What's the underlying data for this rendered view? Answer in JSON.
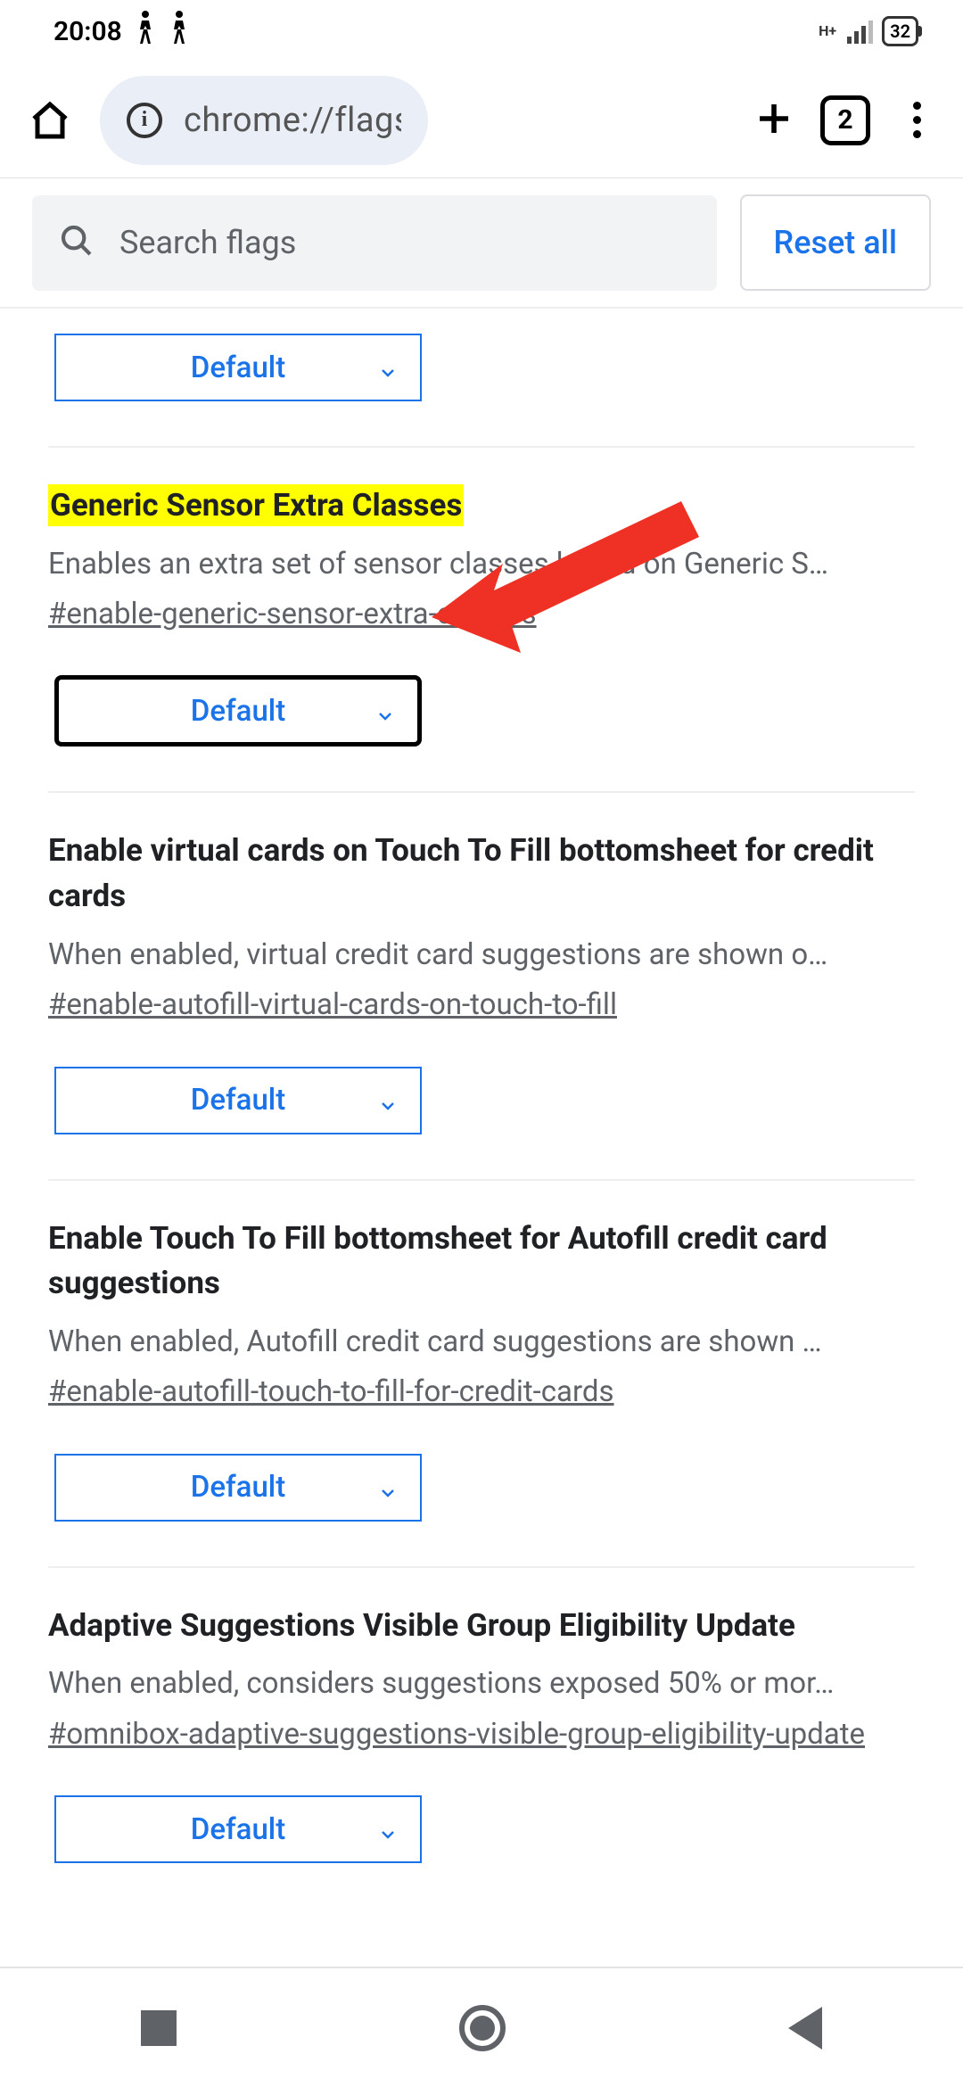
{
  "statusbar": {
    "time": "20:08",
    "network_label": "H+",
    "battery_pct": "32"
  },
  "browser": {
    "url": "chrome://flags/#enab",
    "tab_count": "2"
  },
  "search": {
    "placeholder": "Search flags",
    "reset_label": "Reset all"
  },
  "flags": [
    {
      "title": "",
      "dropdown": "Default"
    },
    {
      "title": "Generic Sensor Extra Classes",
      "desc": "Enables an extra set of sensor classes based on Generic S…",
      "anchor": "#enable-generic-sensor-extra-classes",
      "dropdown": "Default"
    },
    {
      "title": "Enable virtual cards on Touch To Fill bottomsheet for credit cards",
      "desc": "When enabled, virtual credit card suggestions are shown o…",
      "anchor": "#enable-autofill-virtual-cards-on-touch-to-fill",
      "dropdown": "Default"
    },
    {
      "title": "Enable Touch To Fill bottomsheet for Autofill credit card suggestions",
      "desc": "When enabled, Autofill credit card suggestions are shown …",
      "anchor": "#enable-autofill-touch-to-fill-for-credit-cards",
      "dropdown": "Default"
    },
    {
      "title": "Adaptive Suggestions Visible Group Eligibility Update",
      "desc": "When enabled, considers suggestions exposed 50% or mor…",
      "anchor": "#omnibox-adaptive-suggestions-visible-group-eligibility-update",
      "dropdown": "Default"
    }
  ]
}
